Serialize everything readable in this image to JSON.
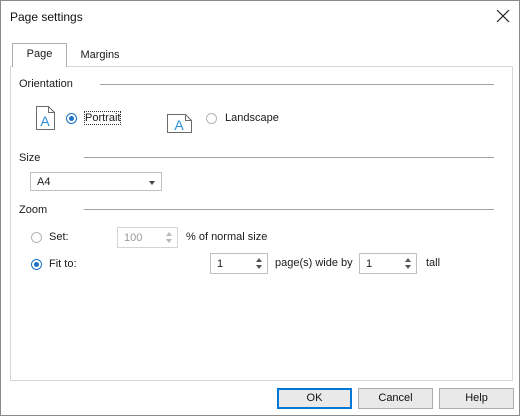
{
  "dialog": {
    "title": "Page settings"
  },
  "tabs": [
    {
      "label": "Page",
      "active": true
    },
    {
      "label": "Margins",
      "active": false
    }
  ],
  "orientation": {
    "group_label": "Orientation",
    "options": [
      {
        "label": "Portrait",
        "selected": true,
        "icon": "portrait-page-icon"
      },
      {
        "label": "Landscape",
        "selected": false,
        "icon": "landscape-page-icon"
      }
    ]
  },
  "size": {
    "group_label": "Size",
    "selected": "A4"
  },
  "zoom": {
    "group_label": "Zoom",
    "set": {
      "label": "Set:",
      "selected": false,
      "value": "100",
      "suffix": "% of normal size"
    },
    "fit_to": {
      "label": "Fit to:",
      "selected": true,
      "wide_value": "1",
      "wide_suffix": "page(s) wide by",
      "tall_value": "1",
      "tall_suffix": "tall"
    }
  },
  "buttons": {
    "ok": "OK",
    "cancel": "Cancel",
    "help": "Help"
  },
  "colors": {
    "accent": "#1a73c7",
    "default_button_border": "#0078d7",
    "icon_blue": "#2b8fd6"
  }
}
